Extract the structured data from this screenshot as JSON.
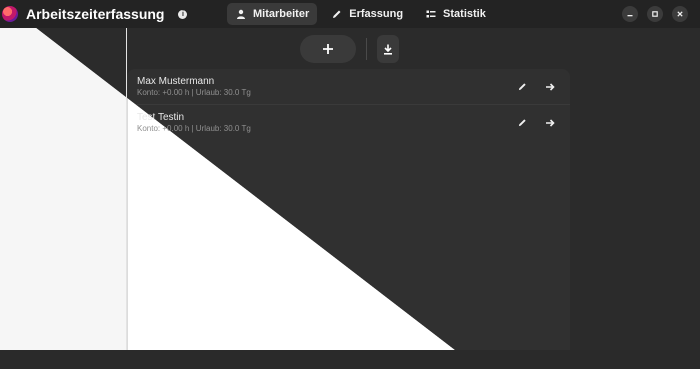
{
  "window": {
    "title": "Arbeitszeiterfassung",
    "info_icon": "info-icon",
    "controls": [
      "minimize-icon",
      "maximize-icon",
      "close-icon"
    ]
  },
  "tabs": [
    {
      "label": "Mitarbeiter",
      "icon": "person-icon",
      "active": true
    },
    {
      "label": "Erfassung",
      "icon": "pencil-icon",
      "active": false
    },
    {
      "label": "Statistik",
      "icon": "list-icon",
      "active": false
    }
  ],
  "toolbar": {
    "add_icon": "plus-icon",
    "download_icon": "download-icon"
  },
  "employees": [
    {
      "name": "Max Mustermann",
      "info": "Konto: +0.00 h | Urlaub: 30.0 Tg"
    },
    {
      "name": "Test Testin",
      "info": "Konto: +0.00 h | Urlaub: 30.0 Tg"
    }
  ],
  "colors": {
    "header_bg": "#232323",
    "panel_bg": "#303030",
    "light_bg": "#f6f6f6",
    "dark_bg": "#2b2b2b",
    "button_bg": "#3a3a3a"
  }
}
